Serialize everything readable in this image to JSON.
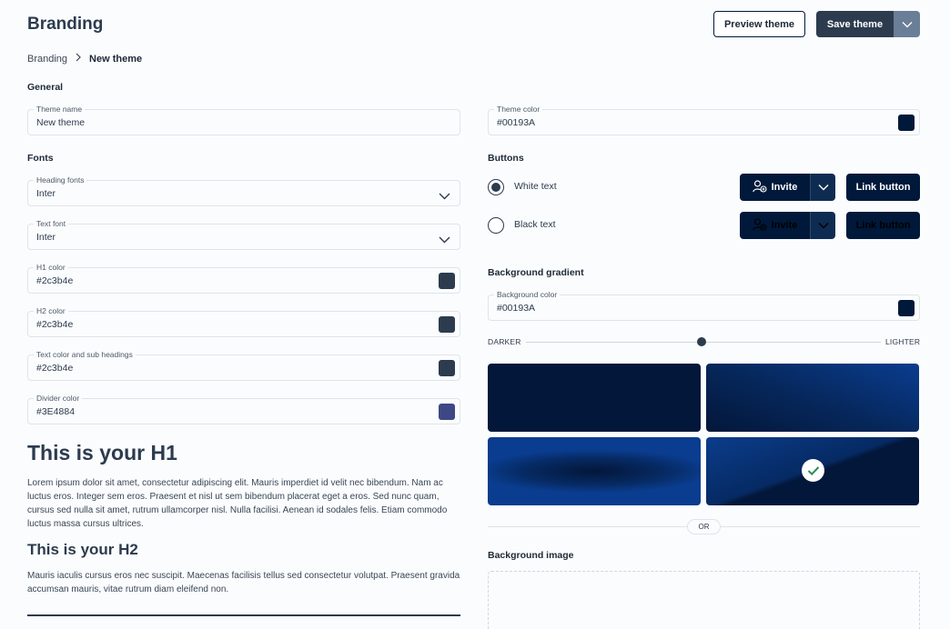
{
  "header": {
    "title": "Branding",
    "preview_label": "Preview theme",
    "save_label": "Save theme"
  },
  "breadcrumb": {
    "root": "Branding",
    "current": "New theme"
  },
  "general": {
    "section": "General",
    "theme_name": {
      "label": "Theme name",
      "value": "New theme"
    },
    "theme_color": {
      "label": "Theme color",
      "value": "#00193A",
      "color": "#00193A"
    }
  },
  "fonts": {
    "section": "Fonts",
    "heading_font": {
      "label": "Heading fonts",
      "value": "Inter"
    },
    "text_font": {
      "label": "Text font",
      "value": "Inter"
    },
    "h1_color": {
      "label": "H1 color",
      "value": "#2c3b4e",
      "color": "#2c3b4e"
    },
    "h2_color": {
      "label": "H2 color",
      "value": "#2c3b4e",
      "color": "#2c3b4e"
    },
    "text_color": {
      "label": "Text color and sub headings",
      "value": "#2c3b4e",
      "color": "#2c3b4e"
    },
    "divider_color": {
      "label": "Divider color",
      "value": "#3E4884",
      "color": "#3E4884"
    }
  },
  "preview": {
    "h1": "This is your H1",
    "p1": "Lorem ipsum dolor sit amet, consectetur adipiscing elit. Mauris imperdiet id velit nec bibendum. Nam ac luctus eros. Integer sem eros. Praesent et nisl ut sem bibendum placerat eget a eros. Sed nunc quam, cursus sed nulla sit amet, rutrum ullamcorper nisl. Nulla facilisi. Aenean id sodales felis. Etiam commodo luctus massa cursus ultrices.",
    "h2": "This is your H2",
    "p2": "Mauris iaculis cursus eros nec suscipit. Maecenas facilisis tellus sed consectetur volutpat. Praesent gravida accumsan mauris, vitae rutrum diam eleifend non."
  },
  "buttons": {
    "section": "Buttons",
    "white_label": "White text",
    "black_label": "Black text",
    "selected": "white",
    "invite_label": "Invite",
    "link_label": "Link button"
  },
  "background": {
    "section": "Background gradient",
    "color": {
      "label": "Background color",
      "value": "#00193A",
      "color": "#00193A"
    },
    "darker": "DARKER",
    "lighter": "LIGHTER",
    "slider_level": 0.5,
    "selected_tile": 4,
    "or": "OR",
    "image_section": "Background image"
  }
}
